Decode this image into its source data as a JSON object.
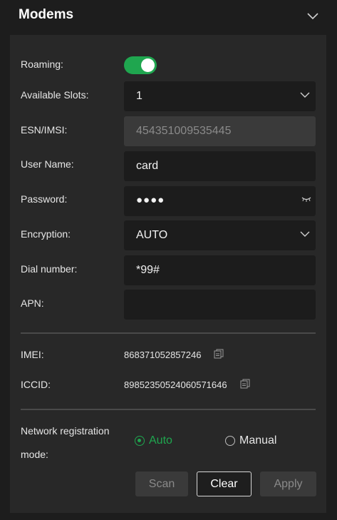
{
  "header": {
    "title": "Modems"
  },
  "colors": {
    "accent": "#1fa64f",
    "panel": "#282828",
    "field": "#1c1c1c"
  },
  "form": {
    "roaming": {
      "label": "Roaming:",
      "on": true
    },
    "slots": {
      "label": "Available Slots:",
      "value": "1"
    },
    "esn": {
      "label": "ESN/IMSI:",
      "value": "454351009535445"
    },
    "username": {
      "label": "User Name:",
      "value": "card"
    },
    "password": {
      "label": "Password:",
      "value": "●●●●",
      "icon": "eye-closed-icon"
    },
    "encryption": {
      "label": "Encryption:",
      "value": "AUTO"
    },
    "dial": {
      "label": "Dial number:",
      "value": "*99#"
    },
    "apn": {
      "label": "APN:",
      "value": ""
    }
  },
  "info": {
    "imei": {
      "label": "IMEI:",
      "value": "868371052857246"
    },
    "iccid": {
      "label": "ICCID:",
      "value": "89852350524060571646"
    }
  },
  "registration": {
    "label_line1": "Network registration",
    "label_line2": "mode:",
    "options": [
      {
        "label": "Auto",
        "checked": true
      },
      {
        "label": "Manual",
        "checked": false
      }
    ]
  },
  "buttons": {
    "scan": "Scan",
    "clear": "Clear",
    "apply": "Apply"
  }
}
